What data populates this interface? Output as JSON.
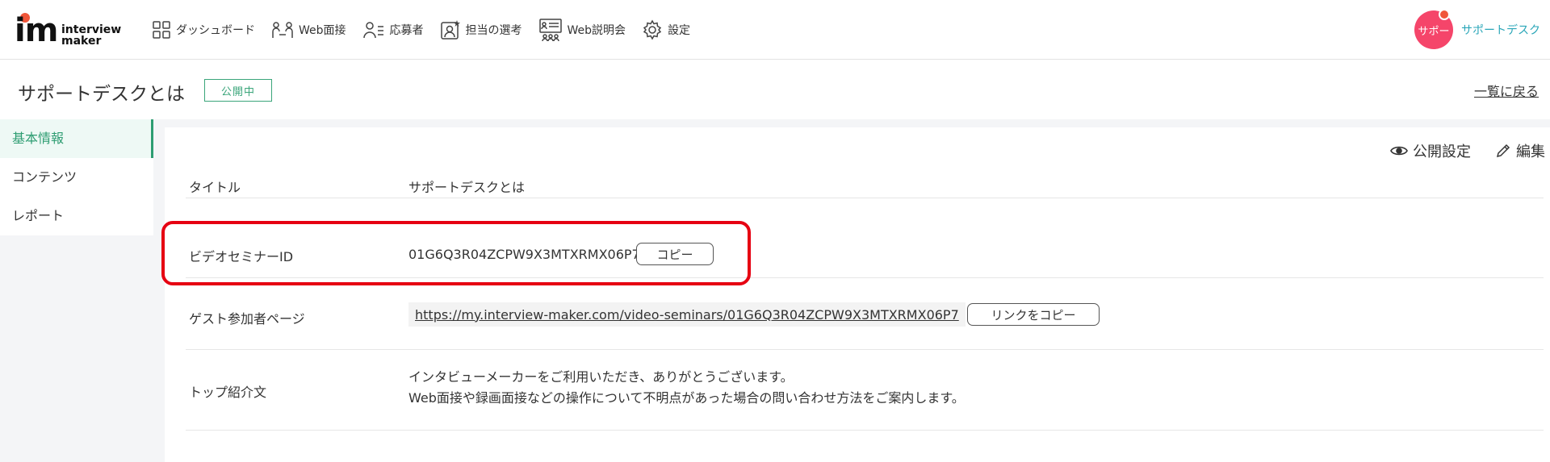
{
  "header": {
    "logo_mark": "im",
    "logo_line1": "interview",
    "logo_line2": "maker",
    "nav": [
      {
        "label": "ダッシュボード",
        "icon": "grid-icon"
      },
      {
        "label": "Web面接",
        "icon": "interview-icon"
      },
      {
        "label": "応募者",
        "icon": "applicant-icon"
      },
      {
        "label": "担当の選考",
        "icon": "selection-icon"
      },
      {
        "label": "Web説明会",
        "icon": "seminar-icon"
      },
      {
        "label": "設定",
        "icon": "gear-icon"
      }
    ],
    "avatar_text": "サポー",
    "user_name": "サポートデスク"
  },
  "title_bar": {
    "title": "サポートデスクとは",
    "status": "公開中",
    "back_label": "一覧に戻る"
  },
  "sidebar": {
    "items": [
      {
        "label": "基本情報",
        "active": true
      },
      {
        "label": "コンテンツ",
        "active": false
      },
      {
        "label": "レポート",
        "active": false
      }
    ]
  },
  "actions": {
    "publish_label": "公開設定",
    "edit_label": "編集"
  },
  "details": {
    "title_label": "タイトル",
    "title_value": "サポートデスクとは",
    "seminar_id_label": "ビデオセミナーID",
    "seminar_id_value": "01G6Q3R04ZCPW9X3MTXRMX06P7",
    "copy_label": "コピー",
    "guest_label": "ゲスト参加者ページ",
    "guest_url": "https://my.interview-maker.com/video-seminars/01G6Q3R04ZCPW9X3MTXRMX06P7",
    "copy_link_label": "リンクをコピー",
    "intro_label": "トップ紹介文",
    "intro_line1": "インタビューメーカーをご利用いただき、ありがとうございます。",
    "intro_line2": "Web面接や録画面接などの操作について不明点があった場合の問い合わせ方法をご案内します。"
  },
  "colors": {
    "accent_green": "#2e9d72",
    "avatar_pink": "#f5456a",
    "highlight_red": "#e60012",
    "user_link": "#2aa6b8"
  }
}
